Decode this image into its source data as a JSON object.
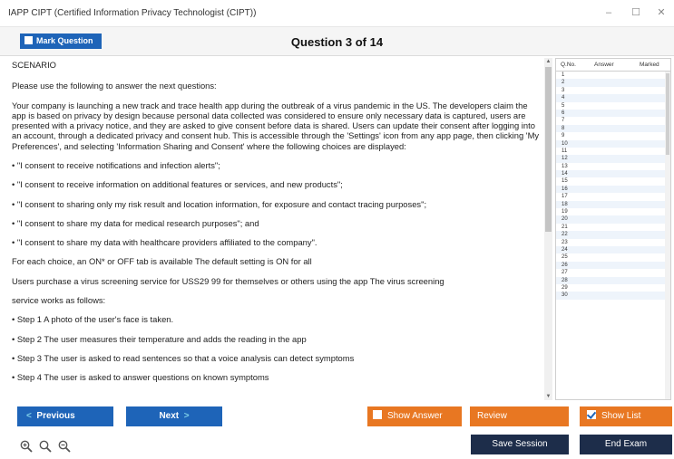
{
  "window": {
    "title": "IAPP CIPT (Certified Information Privacy Technologist (CIPT))",
    "controls": [
      "–",
      "☐",
      "✕"
    ]
  },
  "header": {
    "mark_label": "Mark Question",
    "question_title": "Question 3 of 14"
  },
  "content": {
    "scenario_label": "SCENARIO",
    "paragraphs": [
      "Please use the following to answer the next questions:",
      "Your company is launching a new track and trace health app during the outbreak of a virus pandemic in the US. The developers claim the app is based on privacy by design because personal data collected was considered to ensure only necessary data is captured, users are presented with a privacy notice, and they are asked to give consent before data is shared. Users can update their consent after logging into an account, through a dedicated privacy and consent hub. This is accessible through the 'Settings' icon from any app page, then clicking 'My Preferences', and selecting 'Information Sharing and Consent' where the following choices are displayed:",
      "• \"I consent to receive notifications and infection alerts\";",
      "• \"I consent to receive information on additional features or services, and new products\";",
      "• \"I consent to sharing only my risk result and location information, for exposure and contact tracing purposes\";",
      "• \"I consent to share my data for medical research purposes\"; and",
      "• \"I consent to share my data with healthcare providers affiliated to the company\".",
      "For each choice, an ON* or OFF tab is available The default setting is ON for all",
      "Users purchase a virus screening service for USS29 99 for themselves or others using the app The virus screening",
      "service works as follows:",
      "• Step 1 A photo of the user's face is taken.",
      "• Step 2 The user measures their temperature and adds the reading in the app",
      "• Step 3 The user is asked to read sentences so that a voice analysis can detect symptoms",
      "• Step 4 The user is asked to answer questions on known symptoms"
    ]
  },
  "question_list": {
    "headers": [
      "Q.No.",
      "Answer",
      "Marked"
    ],
    "numbers": [
      "1",
      "2",
      "3",
      "4",
      "5",
      "6",
      "7",
      "8",
      "9",
      "10",
      "11",
      "12",
      "13",
      "14",
      "15",
      "16",
      "17",
      "18",
      "19",
      "20",
      "21",
      "22",
      "23",
      "24",
      "25",
      "26",
      "27",
      "28",
      "29",
      "30"
    ]
  },
  "footer": {
    "previous_label": "Previous",
    "next_label": "Next",
    "show_answer_label": "Show Answer",
    "review_label": "Review",
    "show_list_label": "Show List",
    "save_session_label": "Save Session",
    "end_exam_label": "End Exam"
  },
  "colors": {
    "primary_blue": "#1e64b8",
    "orange": "#e87722",
    "navy": "#1d2d4a",
    "list_alt_row": "#eef4fb"
  },
  "icons": [
    "zoom-in-icon",
    "zoom-reset-icon",
    "zoom-out-icon"
  ]
}
